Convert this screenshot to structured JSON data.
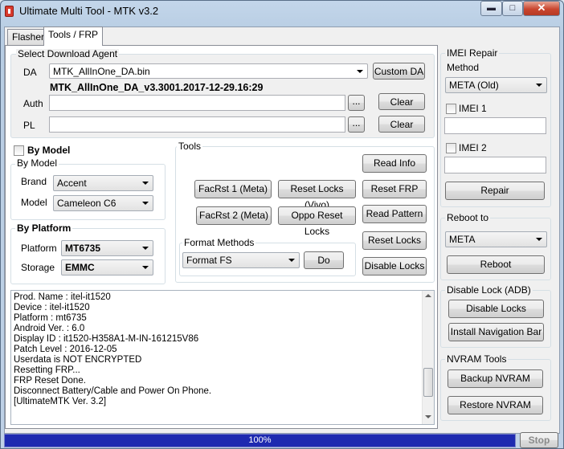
{
  "window": {
    "title": "Ultimate Multi Tool - MTK v3.2",
    "minimize": "▬",
    "maximize": "□",
    "close": "✕"
  },
  "tabs": [
    {
      "label": "Flasher"
    },
    {
      "label": "Tools / FRP"
    }
  ],
  "download_agent": {
    "group_label": "Select Download Agent",
    "da_label": "DA",
    "da_value": "MTK_AllInOne_DA.bin",
    "custom_da_button": "Custom DA",
    "da_version": "MTK_AllInOne_DA_v3.3001.2017-12-29.16:29",
    "auth_label": "Auth",
    "auth_value": "",
    "pl_label": "PL",
    "pl_value": "",
    "browse": "...",
    "clear": "Clear"
  },
  "by_model": {
    "checkbox_label": "By Model",
    "group_label": "By Model",
    "brand_label": "Brand",
    "brand_value": "Accent",
    "model_label": "Model",
    "model_value": "Cameleon C6"
  },
  "by_platform": {
    "group_label": "By Platform",
    "platform_label": "Platform",
    "platform_value": "MT6735",
    "storage_label": "Storage",
    "storage_value": "EMMC"
  },
  "tools": {
    "group_label": "Tools",
    "read_info": "Read Info",
    "facrst1": "FacRst 1 (Meta)",
    "reset_locks_vivo": "Reset Locks (Vivo)",
    "reset_frp": "Reset FRP",
    "facrst2": "FacRst 2 (Meta)",
    "oppo_reset_locks": "Oppo Reset Locks",
    "read_pattern": "Read Pattern",
    "reset_locks": "Reset Locks",
    "disable_locks": "Disable Locks",
    "format_methods_label": "Format Methods",
    "format_value": "Format FS",
    "do": "Do"
  },
  "log": {
    "lines": [
      "Prod. Name : itel-it1520",
      "Device : itel-it1520",
      "Platform : mt6735",
      "Android Ver. : 6.0",
      "Display ID : it1520-H358A1-M-IN-161215V86",
      "Patch Level : 2016-12-05",
      "Userdata is NOT ENCRYPTED",
      "Resetting FRP...",
      "FRP Reset Done.",
      "Disconnect Battery/Cable and Power On Phone.",
      "[UltimateMTK Ver. 3.2]"
    ]
  },
  "imei_repair": {
    "group_label": "IMEI Repair",
    "method_label": "Method",
    "method_value": "META (Old)",
    "imei1_label": "IMEI 1",
    "imei1_value": "",
    "imei2_label": "IMEI 2",
    "imei2_value": "",
    "repair": "Repair"
  },
  "reboot": {
    "group_label": "Reboot to",
    "value": "META",
    "button": "Reboot"
  },
  "disable_lock": {
    "group_label": "Disable Lock (ADB)",
    "disable_locks": "Disable Locks",
    "install_nav": "Install Navigation Bar"
  },
  "nvram": {
    "group_label": "NVRAM Tools",
    "backup": "Backup NVRAM",
    "restore": "Restore NVRAM"
  },
  "status": {
    "progress_text": "100%",
    "progress_fraction": 1.0,
    "stop": "Stop"
  },
  "colors": {
    "progress": "#1e2ab0",
    "accent": "#d83a2d"
  }
}
